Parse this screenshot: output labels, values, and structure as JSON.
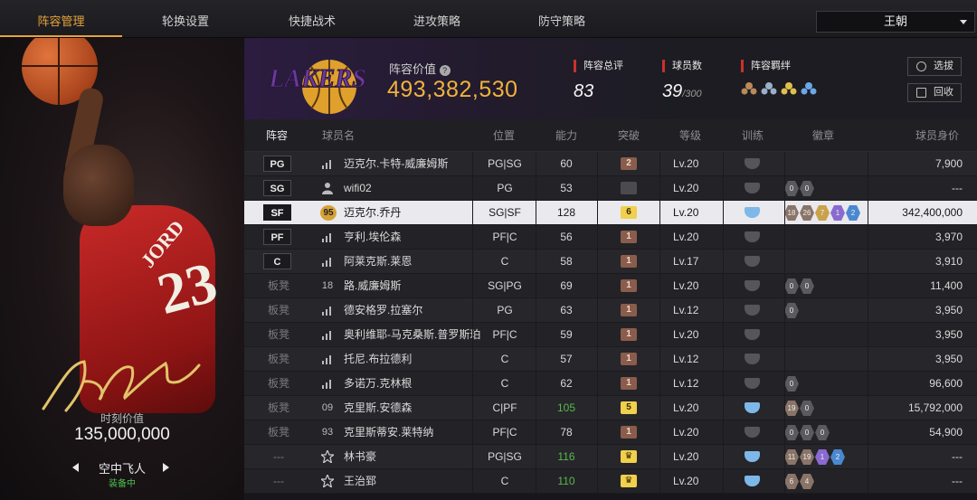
{
  "nav": {
    "tabs": [
      {
        "label": "阵容管理",
        "active": true
      },
      {
        "label": "轮换设置"
      },
      {
        "label": "快捷战术"
      },
      {
        "label": "进攻策略"
      },
      {
        "label": "防守策略"
      }
    ],
    "team_select": "王朝"
  },
  "card": {
    "value_label": "时刻价值",
    "value": "135,000,000",
    "style_name": "空中飞人",
    "equipped": "装备中"
  },
  "header": {
    "value_title": "阵容价值",
    "value": "493,382,530",
    "rating_label": "阵容总评",
    "rating": "83",
    "players_label": "球员数",
    "players": "39",
    "players_max": "/300",
    "bond_label": "阵容羁绊",
    "draft_button": "选拔",
    "recycle_button": "回收"
  },
  "columns": [
    "阵容",
    "球员名",
    "位置",
    "能力",
    "突破",
    "等级",
    "训练",
    "徽章",
    "球员身价"
  ],
  "players": [
    {
      "slot": "PG",
      "icon": "bars",
      "name": "迈克尔.卡特-威廉姆斯",
      "pos": "PG|SG",
      "ability": "60",
      "break": "2",
      "break_style": "brown",
      "level": "Lv.20",
      "train": "gray",
      "badges": [],
      "price": "7,900"
    },
    {
      "slot": "SG",
      "icon": "person",
      "name": "wifi02",
      "pos": "PG",
      "ability": "53",
      "break": "",
      "break_style": "dim",
      "level": "Lv.20",
      "train": "gray",
      "badges": [
        "0",
        "0"
      ],
      "price": "---"
    },
    {
      "slot": "SF",
      "icon": "95",
      "name": "迈克尔.乔丹",
      "pos": "SG|SF",
      "ability": "128",
      "break": "6",
      "break_style": "gold",
      "level": "Lv.20",
      "train": "blue",
      "badges": [
        "18",
        "26",
        "7",
        "1",
        "2"
      ],
      "price": "342,400,000",
      "selected": true
    },
    {
      "slot": "PF",
      "icon": "bars",
      "name": "亨利.埃伦森",
      "pos": "PF|C",
      "ability": "56",
      "break": "1",
      "break_style": "brown",
      "level": "Lv.20",
      "train": "gray",
      "badges": [],
      "price": "3,970"
    },
    {
      "slot": "C",
      "icon": "bars",
      "name": "阿莱克斯.莱恩",
      "pos": "C",
      "ability": "58",
      "break": "1",
      "break_style": "brown",
      "level": "Lv.17",
      "train": "gray",
      "badges": [],
      "price": "3,910"
    },
    {
      "slot": "板凳",
      "icon": "18",
      "name": "路.威廉姆斯",
      "pos": "SG|PG",
      "ability": "69",
      "break": "1",
      "break_style": "brown",
      "level": "Lv.20",
      "train": "gray",
      "badges": [
        "0",
        "0"
      ],
      "price": "11,400"
    },
    {
      "slot": "板凳",
      "icon": "bars",
      "name": "德安格罗.拉塞尔",
      "pos": "PG",
      "ability": "63",
      "break": "1",
      "break_style": "brown",
      "level": "Lv.12",
      "train": "gray",
      "badges": [
        "0"
      ],
      "price": "3,950"
    },
    {
      "slot": "板凳",
      "icon": "bars",
      "name": "奥利维耶-马克桑斯.普罗斯珀",
      "pos": "PF|C",
      "ability": "59",
      "break": "1",
      "break_style": "brown",
      "level": "Lv.20",
      "train": "gray",
      "badges": [],
      "price": "3,950"
    },
    {
      "slot": "板凳",
      "icon": "bars",
      "name": "托尼.布拉德利",
      "pos": "C",
      "ability": "57",
      "break": "1",
      "break_style": "brown",
      "level": "Lv.12",
      "train": "gray",
      "badges": [],
      "price": "3,950"
    },
    {
      "slot": "板凳",
      "icon": "bars",
      "name": "多诺万.克林根",
      "pos": "C",
      "ability": "62",
      "break": "1",
      "break_style": "brown",
      "level": "Lv.12",
      "train": "gray",
      "badges": [
        "0"
      ],
      "price": "96,600"
    },
    {
      "slot": "板凳",
      "icon": "09",
      "name": "克里斯.安德森",
      "pos": "C|PF",
      "ability": "105",
      "break": "5",
      "break_style": "gold",
      "level": "Lv.20",
      "train": "blue",
      "badges": [
        "19",
        "0"
      ],
      "price": "15,792,000",
      "ability_green": true
    },
    {
      "slot": "板凳",
      "icon": "93",
      "name": "克里斯蒂安.莱特纳",
      "pos": "PF|C",
      "ability": "78",
      "break": "1",
      "break_style": "brown",
      "level": "Lv.20",
      "train": "gray",
      "badges": [
        "0",
        "0",
        "0"
      ],
      "price": "54,900"
    },
    {
      "slot": "---",
      "icon": "star",
      "name": "林书豪",
      "pos": "PG|SG",
      "ability": "116",
      "break": "♛",
      "break_style": "gold",
      "level": "Lv.20",
      "train": "blue",
      "badges": [
        "11",
        "19",
        "1",
        "2"
      ],
      "price": "---",
      "ability_green": true
    },
    {
      "slot": "---",
      "icon": "star",
      "name": "王治郅",
      "pos": "C",
      "ability": "110",
      "break": "♛",
      "break_style": "gold",
      "level": "Lv.20",
      "train": "blue",
      "badges": [
        "6",
        "4"
      ],
      "price": "---",
      "ability_green": true
    }
  ],
  "colors": {
    "accent": "#e6a23c",
    "value_gold": "#f0b23e",
    "badge_brown": "#8a7468",
    "badge_gold": "#c9a24c",
    "badge_purple": "#8a6ad0",
    "badge_blue": "#4a88d0"
  }
}
